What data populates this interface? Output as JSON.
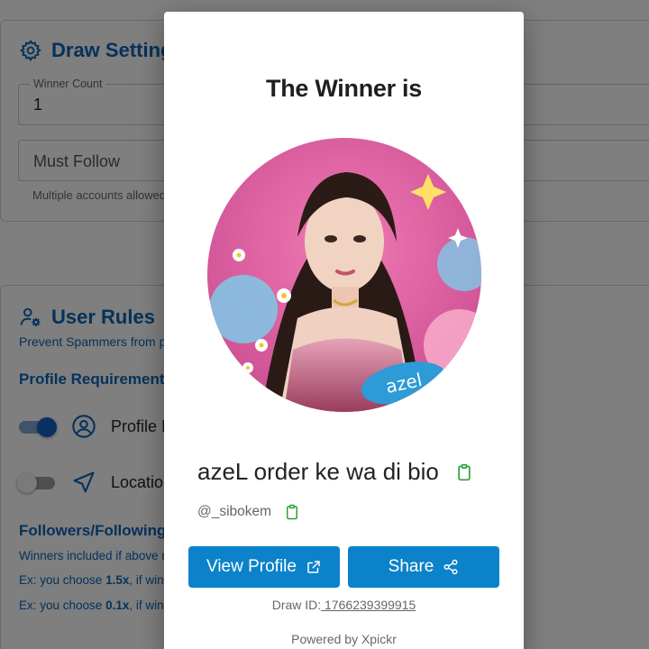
{
  "background": {
    "draw_settings": {
      "title": "Draw Settings",
      "winner_count_label": "Winner Count",
      "winner_count_value": "1",
      "must_follow_placeholder": "Must Follow",
      "helper_text": "Multiple accounts allowed"
    },
    "user_rules": {
      "title": "User Rules",
      "subtitle": "Prevent Spammers from participating",
      "profile_requirements_heading": "Profile Requirements",
      "profile_image_label": "Profile Image",
      "location_label": "Location",
      "followers_heading": "Followers/Following Ratio",
      "followers_desc": "Winners included if above ratio",
      "example_1_prefix": "Ex: you choose ",
      "example_1_value": "1.5x",
      "example_1_suffix": ", if winner",
      "example_2_prefix": "Ex: you choose ",
      "example_2_value": "0.1x",
      "example_2_suffix": ", if winner"
    }
  },
  "modal": {
    "title": "The Winner is",
    "avatar_badge": "azel",
    "winner_name": "azeL order ke wa di bio",
    "winner_handle": "@_sibokem",
    "view_profile_label": "View Profile",
    "share_label": "Share",
    "draw_id_label": "Draw ID:",
    "draw_id_value": " 1766239399915",
    "powered_by": "Powered by Xpickr"
  },
  "colors": {
    "accent": "#0b82c9",
    "heading_blue": "#0a64b6",
    "toggle_on": "#1565c0",
    "clipboard_green": "#2e9e3a"
  },
  "icons": {
    "draw_settings": "gear-icon",
    "user_rules": "user-gear-icon",
    "profile_image": "user-circle-icon",
    "location": "navigation-arrow-icon",
    "copy": "clipboard-icon",
    "view_profile": "external-link-icon",
    "share": "share-icon"
  },
  "toggles": {
    "profile_image_on": true,
    "location_on": false
  }
}
